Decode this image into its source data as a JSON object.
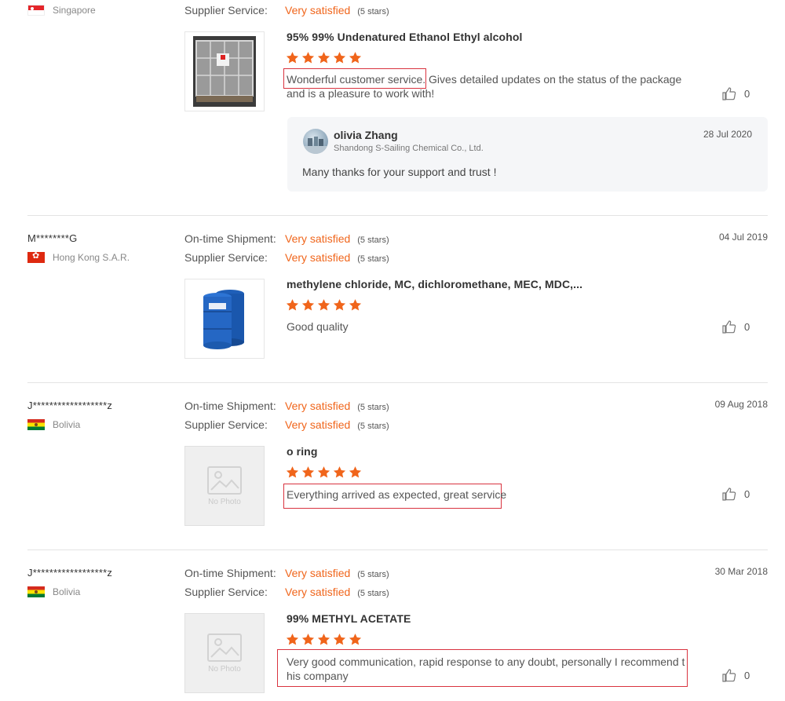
{
  "colors": {
    "accent": "#f0651b",
    "highlight_box": "#d9333f",
    "divider": "#e3e3e3"
  },
  "labels": {
    "on_time": "On-time Shipment:",
    "supplier": "Supplier Service:"
  },
  "reviews": [
    {
      "buyer": "",
      "country": "Singapore",
      "flag": "singapore-flag",
      "date": "",
      "supplier_rating": {
        "value": "Very satisfied",
        "stars": "(5 stars)"
      },
      "product": "95% 99% Undenatured Ethanol Ethyl alcohol",
      "stars": 5,
      "text_highlight": "Wonderful customer service.",
      "text_rest": " Gives detailed updates on the status of the package and is a pleasure to work with!",
      "likes": "0",
      "image": "ibc-tank-photo",
      "reply": {
        "name": "olivia Zhang",
        "company": "Shandong S-Sailing Chemical Co., Ltd.",
        "date": "28 Jul 2020",
        "text": "Many thanks for your support and trust !"
      }
    },
    {
      "buyer": "M********G",
      "country": "Hong Kong S.A.R.",
      "flag": "hong-kong-flag",
      "date": "04 Jul 2019",
      "ontime_rating": {
        "value": "Very satisfied",
        "stars": "(5 stars)"
      },
      "supplier_rating": {
        "value": "Very satisfied",
        "stars": "(5 stars)"
      },
      "product": "methylene chloride, MC, dichloromethane, MEC, MDC,...",
      "stars": 5,
      "text": "Good  quality",
      "likes": "0",
      "image": "blue-drums-photo"
    },
    {
      "buyer": "J******************z",
      "country": "Bolivia",
      "flag": "bolivia-flag",
      "date": "09 Aug 2018",
      "ontime_rating": {
        "value": "Very satisfied",
        "stars": "(5 stars)"
      },
      "supplier_rating": {
        "value": "Very satisfied",
        "stars": "(5 stars)"
      },
      "product": "o ring",
      "stars": 5,
      "text": "Everything arrived as expected, great service",
      "likes": "0",
      "image": "no-photo",
      "no_photo_label": "No Photo"
    },
    {
      "buyer": "J******************z",
      "country": "Bolivia",
      "flag": "bolivia-flag",
      "date": "30 Mar 2018",
      "ontime_rating": {
        "value": "Very satisfied",
        "stars": "(5 stars)"
      },
      "supplier_rating": {
        "value": "Very satisfied",
        "stars": "(5 stars)"
      },
      "product": "99% METHYL ACETATE",
      "stars": 5,
      "text": "Very good communication, rapid response to any doubt, personally I recommend t",
      "text_line2": "his company",
      "likes": "0",
      "image": "no-photo",
      "no_photo_label": "No Photo"
    }
  ]
}
